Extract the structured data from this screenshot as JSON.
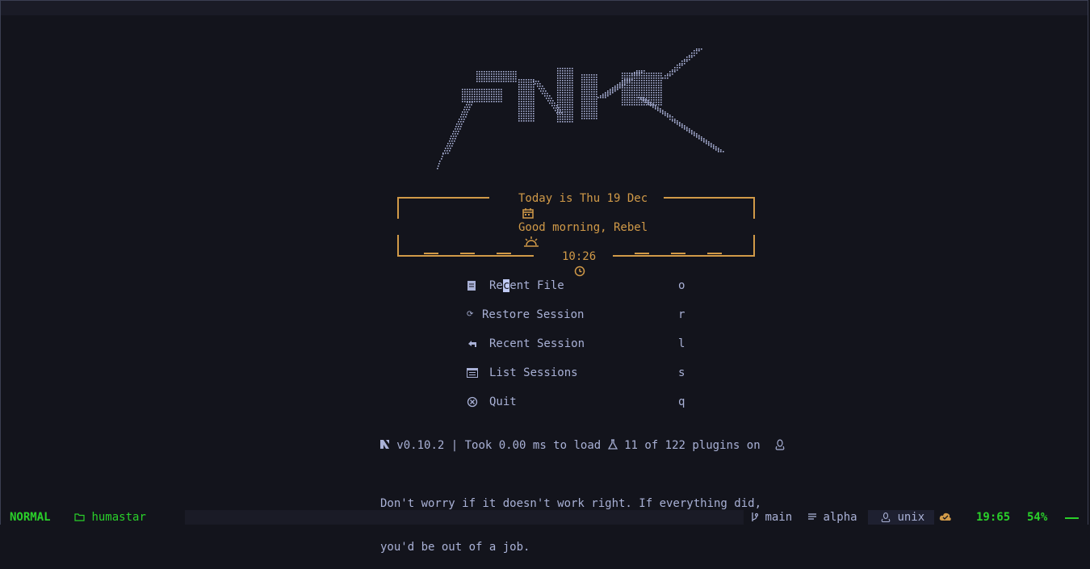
{
  "dashboard": {
    "header_logo": "FNK",
    "date_line": "Today is Thu 19 Dec",
    "greeting": "Good morning, Rebel",
    "clock": "10:26"
  },
  "menu": [
    {
      "icon": "file-icon",
      "label": "Recent File",
      "key": "o"
    },
    {
      "icon": "restore-icon",
      "label": "Restore Session",
      "key": "r"
    },
    {
      "icon": "return-arrow-icon",
      "label": "Recent Session",
      "key": "l"
    },
    {
      "icon": "list-icon",
      "label": "List Sessions",
      "key": "s"
    },
    {
      "icon": "close-circle-icon",
      "label": "Quit",
      "key": "q"
    }
  ],
  "footer": {
    "version": "v0.10.2",
    "load_text": "| Took 0.00 ms to load",
    "plugins_text": "11 of 122 plugins on"
  },
  "quote": {
    "line1": "Don't worry if it doesn't work right. If everything did,",
    "line2": "you'd be out of a job."
  },
  "statusbar": {
    "mode": "NORMAL",
    "cwd": "humastar",
    "branch": "main",
    "filetype": "alpha",
    "fileformat": "unix",
    "time": "19:65",
    "percent": "54%"
  },
  "colors": {
    "accent": "#d19a48",
    "text": "#a9b1d6",
    "status_green": "#2ad02a",
    "background": "#13141c"
  }
}
